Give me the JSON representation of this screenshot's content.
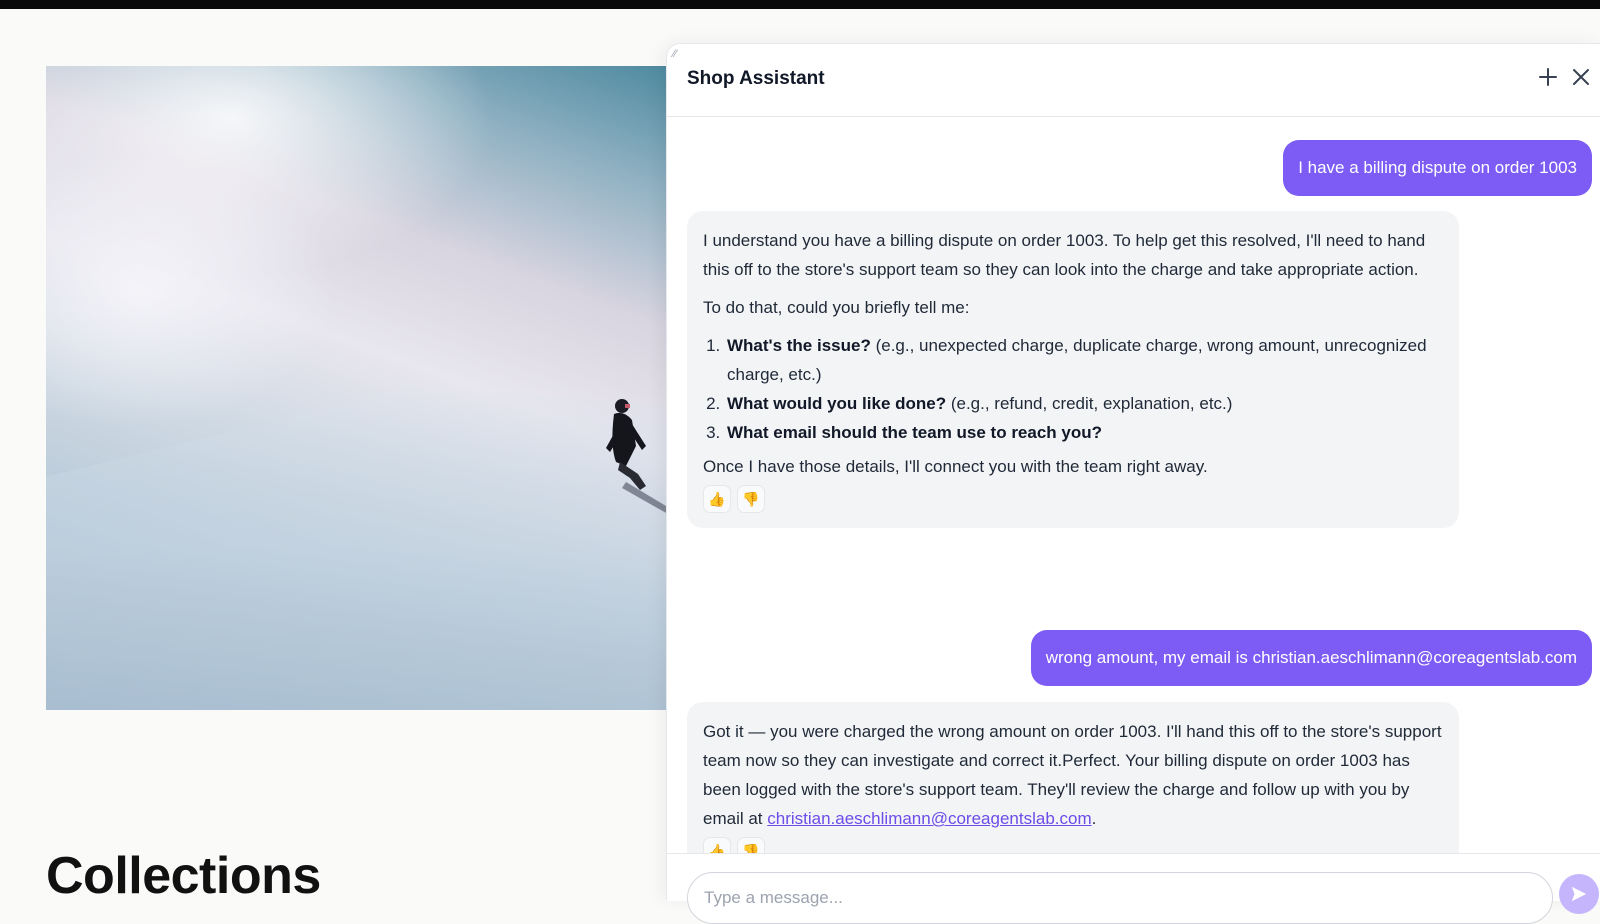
{
  "page": {
    "collections_title": "Collections"
  },
  "chat": {
    "title": "Shop Assistant",
    "messages": {
      "user_1": "I have a billing dispute on order 1003",
      "bot_1": {
        "p1": "I understand you have a billing dispute on order 1003. To help get this resolved, I'll need to hand this off to the store's support team so they can look into the charge and take appropriate action.",
        "p2": "To do that, could you briefly tell me:",
        "items": [
          {
            "bold": "What's the issue?",
            "rest": " (e.g., unexpected charge, duplicate charge, wrong amount, unrecognized charge, etc.)"
          },
          {
            "bold": "What would you like done?",
            "rest": " (e.g., refund, credit, explanation, etc.)"
          },
          {
            "bold": "What email should the team use to reach you?",
            "rest": ""
          }
        ],
        "p3": "Once I have those details, I'll connect you with the team right away."
      },
      "user_2": "wrong amount, my email is christian.aeschlimann@coreagentslab.com",
      "bot_2": {
        "text": "Got it — you were charged the wrong amount on order 1003. I'll hand this off to the store's support team now so they can investigate and correct it.Perfect. Your billing dispute on order 1003 has been logged with the store's support team. They'll review the charge and follow up with you by email at ",
        "email_link": "christian.aeschlimann@coreagentslab.com",
        "end": "."
      }
    },
    "feedback": {
      "up": "👍",
      "down": "👎"
    },
    "input": {
      "placeholder": "Type a message...",
      "value": ""
    }
  },
  "icons": {
    "new_chat": "plus-icon",
    "close": "close-icon",
    "send": "send-icon"
  },
  "colors": {
    "accent": "#7c5cf4",
    "send_disabled": "#c4b5fd",
    "bot_bubble": "#f3f4f6"
  }
}
